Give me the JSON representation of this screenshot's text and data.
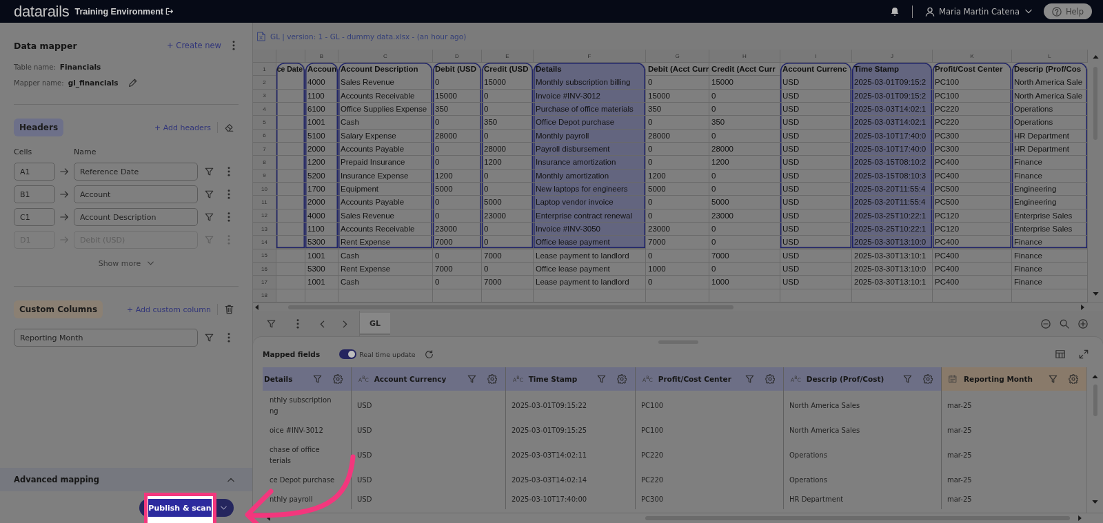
{
  "top_bar": {
    "logo": "datarails",
    "environment": "Training Environment",
    "user": "Maria Martin Catena",
    "help": "Help"
  },
  "data_mapper": {
    "title": "Data mapper",
    "create_link": "+ Create new",
    "table_name": {
      "label": "Table name:",
      "value": "Financials"
    },
    "mapper_name": {
      "label": "Mapper name:",
      "value": "gl_financials"
    }
  },
  "headers": {
    "title": "Headers",
    "add_link": "+ Add headers",
    "cells_label": "Cells",
    "name_label": "Name",
    "mappings": [
      {
        "cell": "A1",
        "name": "Reference Date",
        "disabled": false
      },
      {
        "cell": "B1",
        "name": "Account",
        "disabled": false
      },
      {
        "cell": "C1",
        "name": "Account Description",
        "disabled": false
      },
      {
        "cell": "D1",
        "name": "Debit (USD)",
        "disabled": true
      }
    ],
    "show_more": "Show more"
  },
  "custom_columns": {
    "title": "Custom Columns",
    "add_link": "+ Add custom column",
    "items": [
      {
        "name": "Reporting Month"
      }
    ]
  },
  "advanced_mapping": {
    "title": "Advanced mapping"
  },
  "footer": {
    "publish_button": "Publish & scan"
  },
  "sheet": {
    "file_title": "GL | version: 1 - GL - dummy data.xlsx - (an hour ago)",
    "column_letters": [
      "B",
      "C",
      "D",
      "E",
      "F",
      "G",
      "H",
      "I",
      "J",
      "K",
      "L"
    ],
    "header_row": {
      "number": "1",
      "cells": [
        {
          "text": "ce Date",
          "mapped": true,
          "selected": false
        },
        {
          "text": "Accoun",
          "mapped": true,
          "selected": false
        },
        {
          "text": "Account Description",
          "mapped": true,
          "selected": false
        },
        {
          "text": "Debit (USD",
          "mapped": true,
          "selected": false
        },
        {
          "text": "Credit (USD",
          "mapped": true,
          "selected": false
        },
        {
          "text": "Details",
          "mapped": true,
          "selected": true
        },
        {
          "text": "Debit (Acct Curr",
          "mapped": false,
          "selected": false
        },
        {
          "text": "Credit (Acct Curr",
          "mapped": false,
          "selected": false
        },
        {
          "text": "Account Currenc",
          "mapped": true,
          "selected": false
        },
        {
          "text": "Time Stamp",
          "mapped": true,
          "selected": true
        },
        {
          "text": "Profit/Cost Center",
          "mapped": true,
          "selected": false
        },
        {
          "text": "Descrip (Prof/Cos",
          "mapped": true,
          "selected": false
        }
      ]
    },
    "data_rows": [
      {
        "number": "2",
        "cells": [
          "4000",
          "Sales Revenue",
          "0",
          "15000",
          "Monthly subscription billing",
          "0",
          "15000",
          "USD",
          "2025-03-01T09:15:2",
          "PC100",
          "North America Sale"
        ]
      },
      {
        "number": "3",
        "cells": [
          "1100",
          "Accounts Receivable",
          "15000",
          "0",
          "Invoice #INV-3012",
          "15000",
          "0",
          "USD",
          "2025-03-01T09:15:2",
          "PC100",
          "North America Sale"
        ]
      },
      {
        "number": "4",
        "cells": [
          "6100",
          "Office Supplies Expense",
          "350",
          "0",
          "Purchase of office materials",
          "350",
          "0",
          "USD",
          "2025-03-03T14:02:1",
          "PC220",
          "Operations"
        ]
      },
      {
        "number": "5",
        "cells": [
          "1001",
          "Cash",
          "0",
          "350",
          "Office Depot purchase",
          "0",
          "350",
          "USD",
          "2025-03-03T14:02:1",
          "PC220",
          "Operations"
        ]
      },
      {
        "number": "6",
        "cells": [
          "5100",
          "Salary Expense",
          "28000",
          "0",
          "Monthly payroll",
          "28000",
          "0",
          "USD",
          "2025-03-10T17:40:0",
          "PC300",
          "HR Department"
        ]
      },
      {
        "number": "7",
        "cells": [
          "2000",
          "Accounts Payable",
          "0",
          "28000",
          "Payroll disbursement",
          "0",
          "28000",
          "USD",
          "2025-03-10T17:40:0",
          "PC300",
          "HR Department"
        ]
      },
      {
        "number": "8",
        "cells": [
          "1200",
          "Prepaid Insurance",
          "0",
          "1200",
          "Insurance amortization",
          "0",
          "1200",
          "USD",
          "2025-03-15T08:10:2",
          "PC400",
          "Finance"
        ]
      },
      {
        "number": "9",
        "cells": [
          "5200",
          "Insurance Expense",
          "1200",
          "0",
          "Monthly amortization",
          "1200",
          "0",
          "USD",
          "2025-03-15T08:10:3",
          "PC400",
          "Finance"
        ]
      },
      {
        "number": "10",
        "cells": [
          "1700",
          "Equipment",
          "5000",
          "0",
          "New laptops for engineers",
          "5000",
          "0",
          "USD",
          "2025-03-20T11:55:4",
          "PC500",
          "Engineering"
        ]
      },
      {
        "number": "11",
        "cells": [
          "2000",
          "Accounts Payable",
          "0",
          "5000",
          "Laptop vendor invoice",
          "0",
          "5000",
          "USD",
          "2025-03-20T11:55:4",
          "PC500",
          "Engineering"
        ]
      },
      {
        "number": "12",
        "cells": [
          "4000",
          "Sales Revenue",
          "0",
          "23000",
          "Enterprise contract renewal",
          "0",
          "23000",
          "USD",
          "2025-03-25T10:22:1",
          "PC120",
          "Enterprise Sales"
        ]
      },
      {
        "number": "13",
        "cells": [
          "1100",
          "Accounts Receivable",
          "23000",
          "0",
          "Invoice #INV-3050",
          "23000",
          "0",
          "USD",
          "2025-03-25T10:22:1",
          "PC120",
          "Enterprise Sales"
        ]
      },
      {
        "number": "14",
        "cells": [
          "5300",
          "Rent Expense",
          "7000",
          "0",
          "Office lease payment",
          "7000",
          "0",
          "USD",
          "2025-03-30T13:10:0",
          "PC400",
          "Finance"
        ]
      },
      {
        "number": "15",
        "cells": [
          "1001",
          "Cash",
          "0",
          "7000",
          "Lease payment to landlord",
          "0",
          "7000",
          "USD",
          "2025-03-30T13:10:1",
          "PC400",
          "Finance"
        ]
      },
      {
        "number": "16",
        "cells": [
          "5300",
          "Rent Expense",
          "7000",
          "0",
          "Office lease payment",
          "1000",
          "0",
          "USD",
          "2025-03-30T13:10:0",
          "PC400",
          "Finance"
        ]
      },
      {
        "number": "17",
        "cells": [
          "1001",
          "Cash",
          "0",
          "7000",
          "Lease payment to landlord",
          "0",
          "1000",
          "USD",
          "2025-03-30T13:10:1",
          "PC400",
          "Finance"
        ]
      }
    ],
    "empty_rows": [
      "18"
    ],
    "tabs": [
      {
        "label": "GL",
        "selected": true
      }
    ]
  },
  "mapped_fields": {
    "title": "Mapped fields",
    "realtime": {
      "label": "Real time update",
      "on": true
    },
    "columns": [
      {
        "label": "Details",
        "kind": "plain",
        "custom": false
      },
      {
        "label": "Account Currency",
        "kind": "text",
        "type_mark": "A$^{B}$C",
        "custom": false
      },
      {
        "label": "Time Stamp",
        "kind": "text",
        "type_mark": "A$^{B}$C",
        "custom": false
      },
      {
        "label": "Profit/Cost Center",
        "kind": "text",
        "type_mark": "A$^{B}$C",
        "custom": false
      },
      {
        "label": "Descrip (Prof/Cost)",
        "kind": "text",
        "type_mark": "A$^{B}$C",
        "custom": false
      },
      {
        "label": "Reporting Month",
        "kind": "date",
        "custom": true
      }
    ],
    "rows": [
      [
        "nthly subscription\nng",
        "USD",
        "2025-03-01T09:15:22",
        "PC100",
        "North America Sales",
        "mar-25"
      ],
      [
        "oice #INV-3012",
        "USD",
        "2025-03-01T09:15:25",
        "PC100",
        "North America Sales",
        "mar-25"
      ],
      [
        "chase of office\nterials",
        "USD",
        "2025-03-03T14:02:11",
        "PC220",
        "Operations",
        "mar-25"
      ],
      [
        "ce Depot purchase",
        "USD",
        "2025-03-03T14:02:14",
        "PC220",
        "Operations",
        "mar-25"
      ],
      [
        "nthly payroll",
        "USD",
        "2025-03-10T17:40:00",
        "PC300",
        "HR Department",
        "mar-25"
      ]
    ]
  }
}
